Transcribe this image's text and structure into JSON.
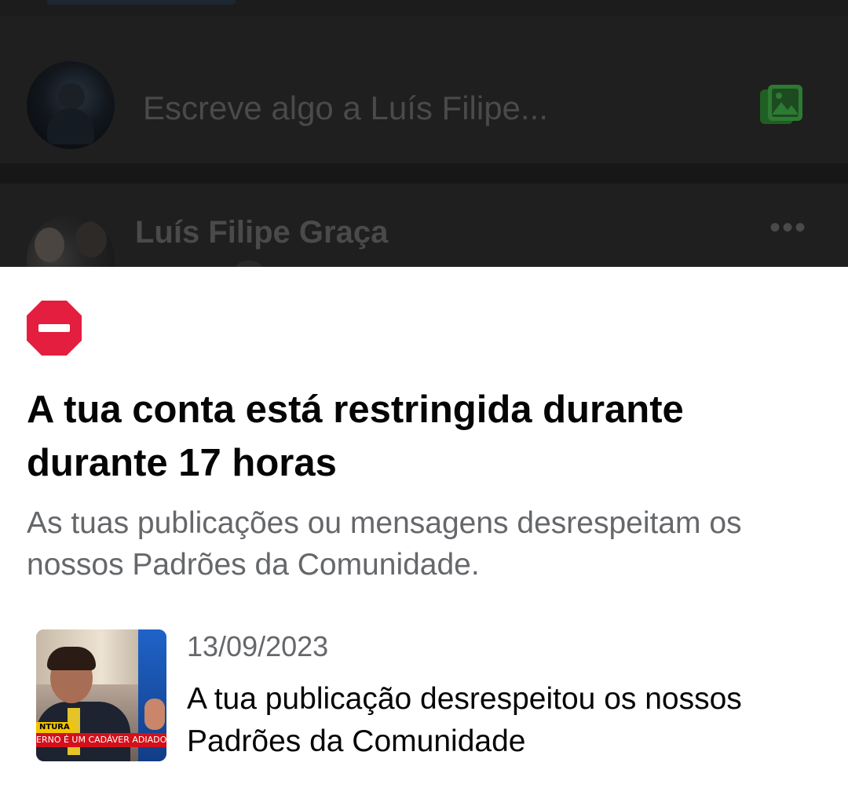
{
  "background": {
    "composer": {
      "placeholder": "Escreve algo a Luís Filipe...",
      "photo_icon": "photo-gallery-icon"
    },
    "post": {
      "author": "Luís Filipe Graça",
      "more_icon": "more-options-icon"
    }
  },
  "sheet": {
    "icon": "stop-sign-icon",
    "icon_color": "#e41e3f",
    "title": "A tua conta está restringida durante durante 17 horas",
    "description": "As tuas publicações ou mensagens desrespeitam os nossos Padrões da Comunidade.",
    "violation": {
      "date": "13/09/2023",
      "text": "A tua publicação desrespeitou os nossos Padrões da Comunidade",
      "thumbnail": {
        "ticker_tag": "NTURA",
        "ticker_text": "ERNO É UM CADÁVER ADIADO\""
      }
    }
  },
  "colors": {
    "title": "#050505",
    "secondary_text": "#65676b",
    "dim_background": "#1f1f1f"
  }
}
